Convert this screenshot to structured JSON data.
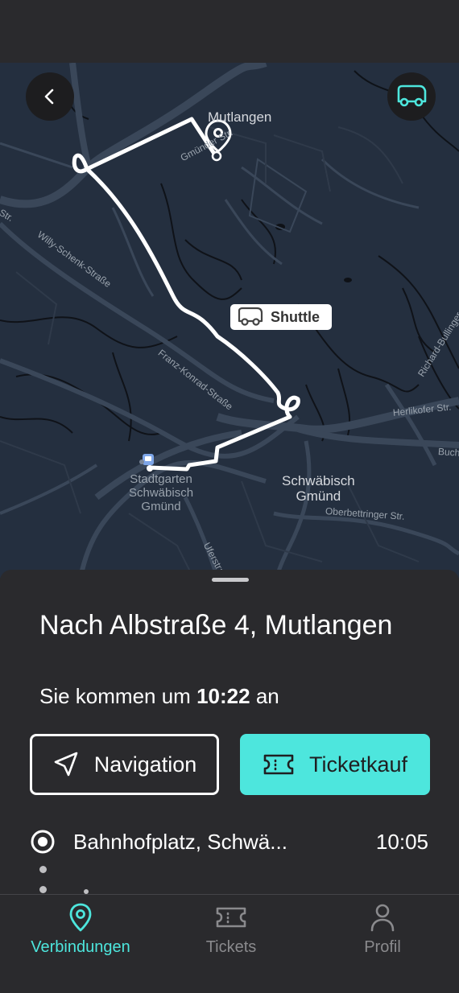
{
  "map": {
    "place_labels": [
      {
        "text": "Mutlangen"
      },
      {
        "text": "Schwäbisch\nGmünd"
      },
      {
        "text": "Stadtgarten\nSchwäbisch\nGmünd"
      }
    ],
    "street_labels": [
      "Willy-Schenk-Straße",
      "Franz-Konrad-Straße",
      "Herlikofer Str.",
      "Oberbettringer Str.",
      "Richard-Bullinger",
      "Uferstraße",
      "Buch",
      "Gmünder Str.",
      "Str."
    ],
    "vehicle_tag": "Shuttle",
    "route_color": "#ffffff",
    "accent_color": "#4de6dd"
  },
  "header": {
    "back_icon": "chevron-left-icon",
    "vehicle_icon": "shuttle-bus-icon"
  },
  "trip": {
    "destination": "Nach Albstraße 4, Mutlangen",
    "arrival_prefix": "Sie kommen um",
    "arrival_time": "10:22",
    "arrival_suffix": "an"
  },
  "actions": {
    "navigation_label": "Navigation",
    "ticket_label": "Ticketkauf"
  },
  "stops": [
    {
      "name": "Bahnhofplatz, Schwä...",
      "time": "10:05"
    }
  ],
  "tabbar": {
    "tabs": [
      {
        "label": "Verbindungen",
        "icon": "location-pin-icon",
        "active": true
      },
      {
        "label": "Tickets",
        "icon": "ticket-icon",
        "active": false
      },
      {
        "label": "Profil",
        "icon": "person-icon",
        "active": false
      }
    ]
  }
}
